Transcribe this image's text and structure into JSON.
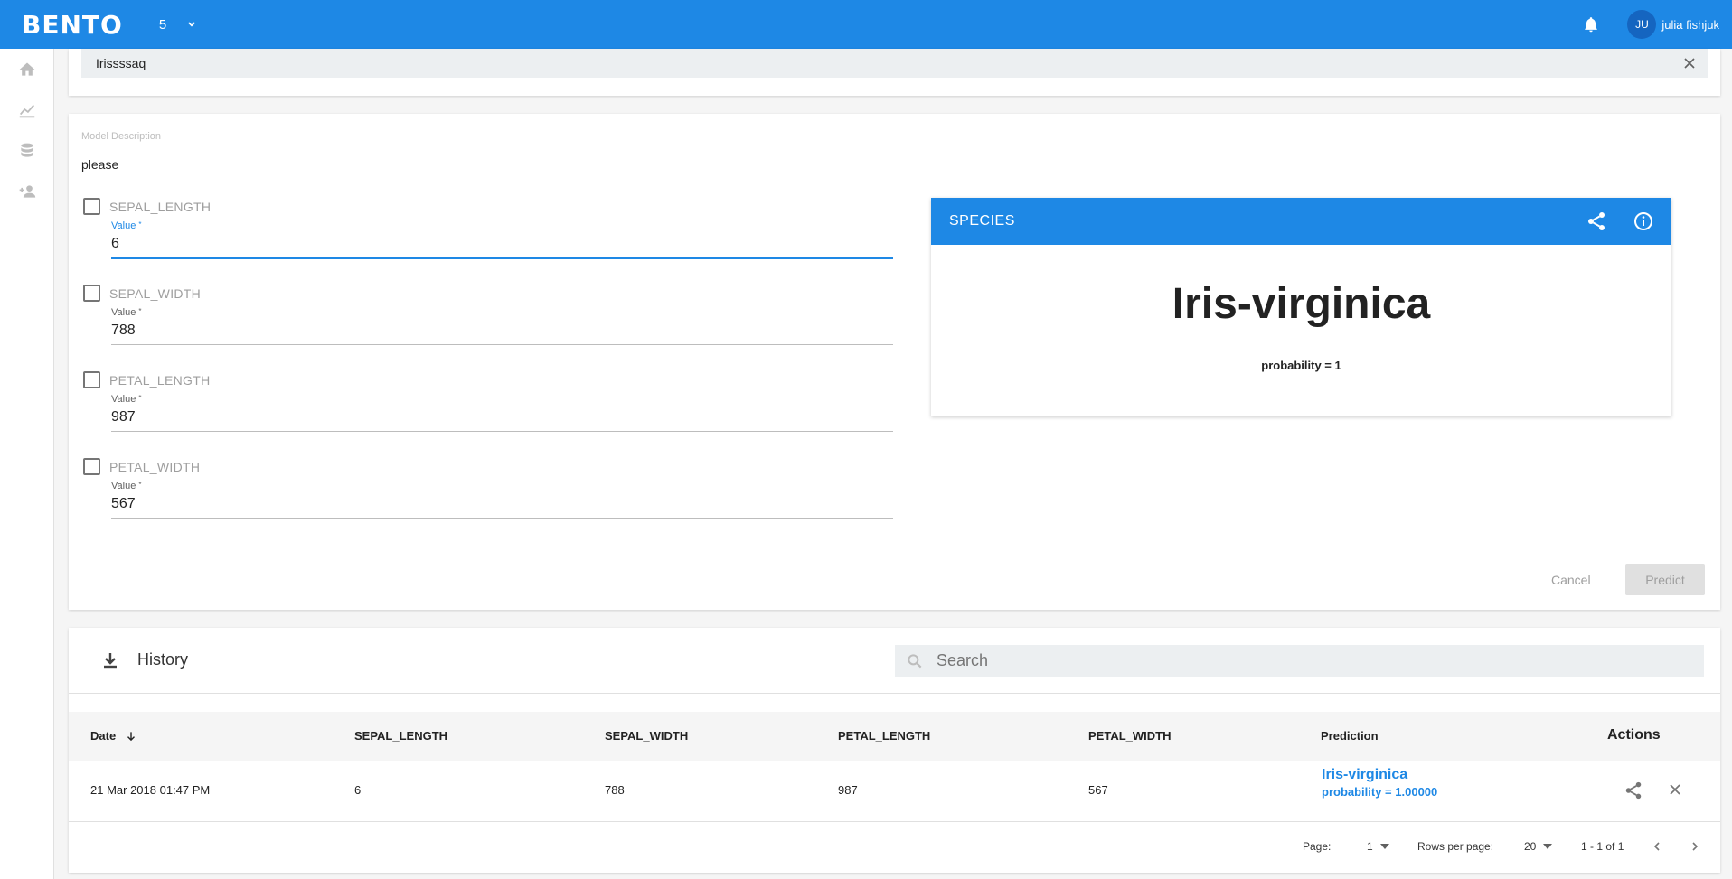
{
  "topbar": {
    "brand": "BENTO",
    "project": "5",
    "user_initials": "JU",
    "user_name": "julia fishjuk"
  },
  "model": {
    "name": "Irissssaq",
    "description_label": "Model Description",
    "description": "please"
  },
  "features": [
    {
      "name": "SEPAL_LENGTH",
      "value_label": "Value",
      "value": "6"
    },
    {
      "name": "SEPAL_WIDTH",
      "value_label": "Value",
      "value": "788"
    },
    {
      "name": "PETAL_LENGTH",
      "value_label": "Value",
      "value": "987"
    },
    {
      "name": "PETAL_WIDTH",
      "value_label": "Value",
      "value": "567"
    }
  ],
  "required_mark": "*",
  "result": {
    "title": "SPECIES",
    "prediction": "Iris-virginica",
    "probability": "probability = 1"
  },
  "actions": {
    "cancel": "Cancel",
    "predict": "Predict"
  },
  "history": {
    "title": "History",
    "search_placeholder": "Search",
    "columns": [
      "Date",
      "SEPAL_LENGTH",
      "SEPAL_WIDTH",
      "PETAL_LENGTH",
      "PETAL_WIDTH",
      "Prediction",
      "Actions"
    ],
    "rows": [
      {
        "date": "21 Mar 2018 01:47 PM",
        "sepal_length": "6",
        "sepal_width": "788",
        "petal_length": "987",
        "petal_width": "567",
        "prediction": "Iris-virginica",
        "probability": "probability = 1.00000"
      }
    ],
    "page_label": "Page:",
    "page": "1",
    "rows_per_page_label": "Rows per page:",
    "rows_per_page": "20",
    "range": "1 - 1 of 1"
  },
  "colors": {
    "primary": "#1e88e5",
    "surface": "#ffffff",
    "muted": "#9e9e9e"
  }
}
